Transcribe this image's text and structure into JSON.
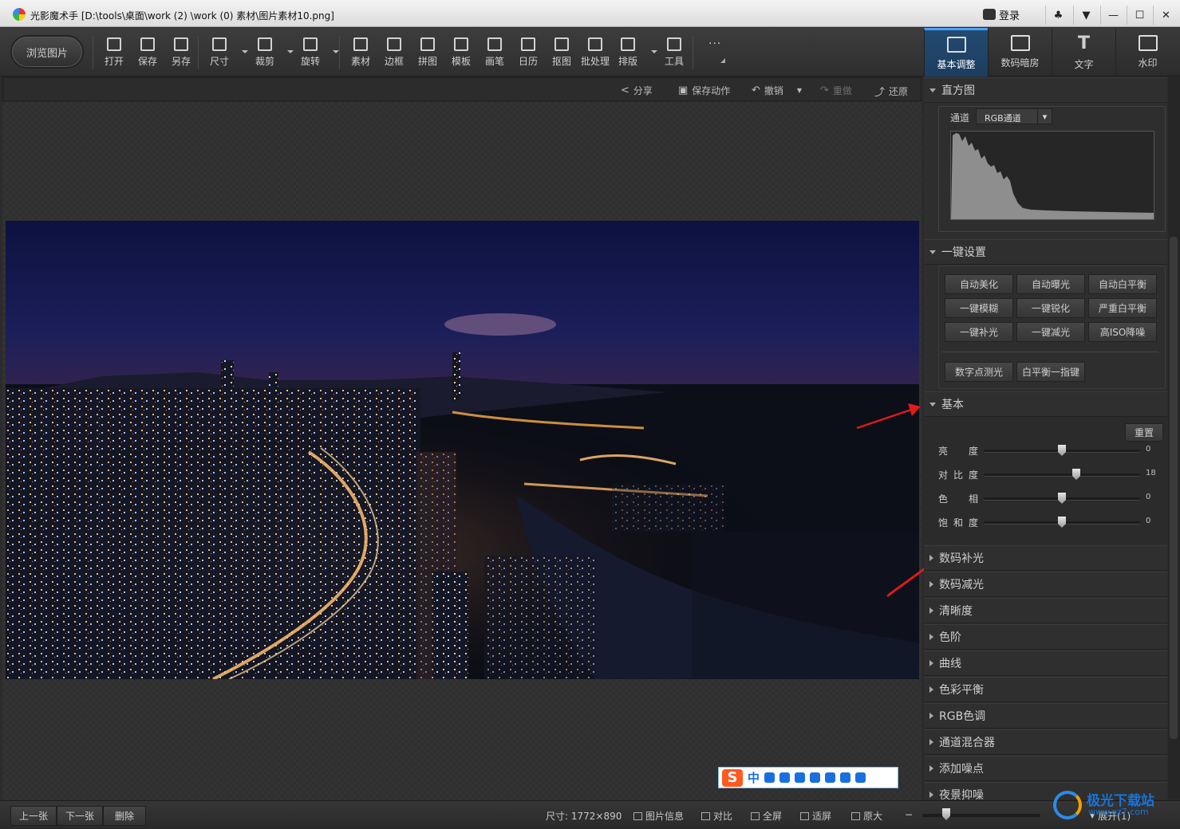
{
  "titlebar": {
    "app_name": "光影魔术手",
    "path": "[D:\\tools\\桌面\\work (2) \\work (0) 素材\\图片素材10.png]",
    "login_label": "登录",
    "buttons": [
      "♣",
      "▼",
      "—",
      "☐",
      "✕"
    ]
  },
  "toolbar": {
    "browse_label": "浏览图片",
    "tools": [
      {
        "label": "打开",
        "icon": "open-icon"
      },
      {
        "label": "保存",
        "icon": "save-icon"
      },
      {
        "label": "另存",
        "icon": "save-as-icon"
      },
      {
        "label": "尺寸",
        "icon": "resize-icon"
      },
      {
        "label": "裁剪",
        "icon": "crop-icon"
      },
      {
        "label": "旋转",
        "icon": "rotate-icon"
      },
      {
        "label": "素材",
        "icon": "material-icon"
      },
      {
        "label": "边框",
        "icon": "border-icon"
      },
      {
        "label": "拼图",
        "icon": "collage-icon"
      },
      {
        "label": "模板",
        "icon": "template-icon"
      },
      {
        "label": "画笔",
        "icon": "brush-icon"
      },
      {
        "label": "日历",
        "icon": "calendar-icon"
      },
      {
        "label": "抠图",
        "icon": "cutout-icon"
      },
      {
        "label": "批处理",
        "icon": "batch-icon"
      },
      {
        "label": "排版",
        "icon": "layout-icon"
      },
      {
        "label": "工具",
        "icon": "wrench-icon"
      }
    ],
    "more_label": "···"
  },
  "right_tabs": [
    {
      "label": "基本调整",
      "active": true
    },
    {
      "label": "数码暗房",
      "active": false
    },
    {
      "label": "文字",
      "active": false,
      "glyph": "T"
    },
    {
      "label": "水印",
      "active": false
    }
  ],
  "actionbar": {
    "share": "分享",
    "save_action": "保存动作",
    "undo": "撤销",
    "redo": "重做",
    "restore": "还原"
  },
  "panel": {
    "histogram": {
      "title": "直方图",
      "channel_label": "通道",
      "channel_value": "RGB通道"
    },
    "oneclick": {
      "title": "一键设置",
      "buttons": [
        "自动美化",
        "自动曝光",
        "自动白平衡",
        "一键模糊",
        "一键锐化",
        "严重白平衡",
        "一键补光",
        "一键减光",
        "高ISO降噪"
      ],
      "buttons2": [
        "数字点测光",
        "白平衡一指键"
      ]
    },
    "basic": {
      "title": "基本",
      "reset": "重置",
      "sliders": [
        {
          "label": "亮度",
          "value": "0",
          "fraction": 0.5
        },
        {
          "label": "对比度",
          "value": "18",
          "fraction": 0.59
        },
        {
          "label": "色相",
          "value": "0",
          "fraction": 0.5
        },
        {
          "label": "饱和度",
          "value": "0",
          "fraction": 0.5
        }
      ]
    },
    "collapsed_sections": [
      "数码补光",
      "数码减光",
      "清晰度",
      "色阶",
      "曲线",
      "色彩平衡",
      "RGB色调",
      "通道混合器",
      "添加噪点",
      "夜景抑噪"
    ]
  },
  "statusbar": {
    "prev": "上一张",
    "next": "下一张",
    "delete": "删除",
    "size": "尺寸: 1772×890",
    "info": "图片信息",
    "compare": "对比",
    "fullscreen": "全屏",
    "fit": "适屏",
    "original": "原大",
    "expand": "展开(1)",
    "zoom_fraction": 0.2
  },
  "ime": {
    "zh": "中",
    "logo": "S"
  },
  "watermark": {
    "text": "极光下载站",
    "url": "www.xz7.com"
  },
  "colors": {
    "accent": "#4aa3ff",
    "active_tab": "#244a70",
    "arrow": "#e01b1b"
  }
}
